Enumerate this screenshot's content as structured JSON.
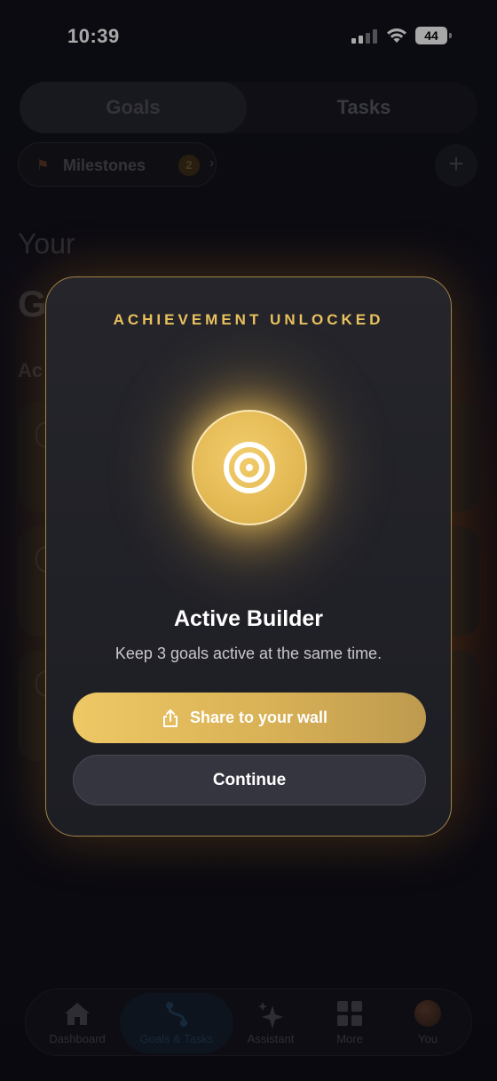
{
  "status_bar": {
    "time": "10:39",
    "battery": "44"
  },
  "segmented": {
    "goals": "Goals",
    "tasks": "Tasks"
  },
  "milestones": {
    "label": "Milestones",
    "count": "2"
  },
  "background": {
    "your": "Your",
    "g": "G",
    "ac": "Ac"
  },
  "modal": {
    "title": "ACHIEVEMENT UNLOCKED",
    "achievement_name": "Active Builder",
    "description": "Keep 3 goals active at the same time.",
    "share_label": "Share to your wall",
    "continue_label": "Continue",
    "badge_icon": "target-icon"
  },
  "tabbar": {
    "items": [
      {
        "label": "Dashboard",
        "icon": "house-icon"
      },
      {
        "label": "Goals & Tasks",
        "icon": "path-icon",
        "active": true
      },
      {
        "label": "Assistant",
        "icon": "sparkles-icon"
      },
      {
        "label": "More",
        "icon": "grid-icon"
      },
      {
        "label": "You",
        "icon": "avatar"
      }
    ]
  },
  "colors": {
    "accent_gold": "#e9c15d",
    "modal_bg": "#222229",
    "button_gold_start": "#eec865",
    "button_gold_end": "#bd9a4f"
  }
}
